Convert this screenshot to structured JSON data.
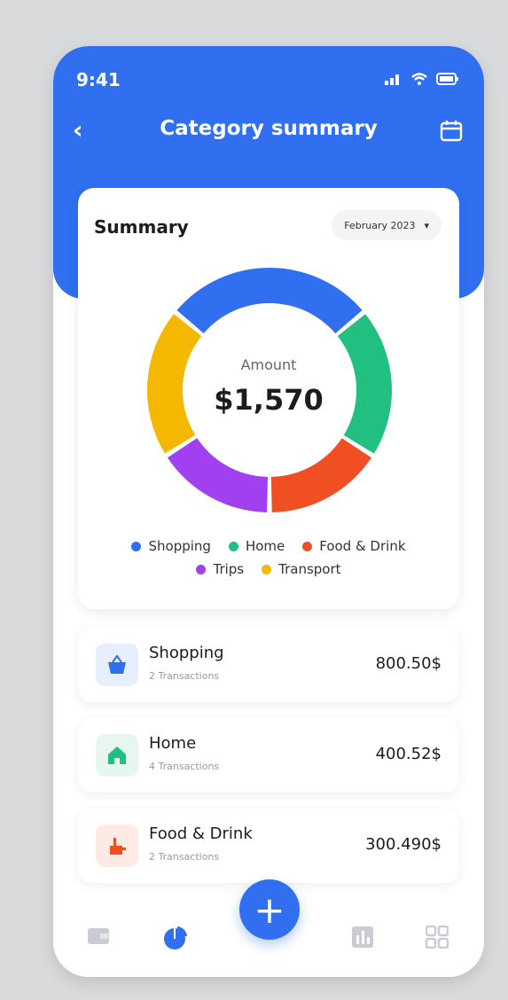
{
  "status_bar": {
    "time": "9:41"
  },
  "header": {
    "title": "Category summary"
  },
  "summary": {
    "title": "Summary",
    "month": "February 2023",
    "amount_label": "Amount",
    "amount_value": "$1,570"
  },
  "chart_data": {
    "type": "pie",
    "categories": [
      "Shopping",
      "Home",
      "Food & Drink",
      "Trips",
      "Transport"
    ],
    "values": [
      28,
      20,
      16,
      16,
      20
    ],
    "colors": [
      "#2f6ff0",
      "#22c080",
      "#f04f23",
      "#a040f0",
      "#f5b800"
    ]
  },
  "legend": [
    {
      "label": "Shopping",
      "color": "#2f6ff0"
    },
    {
      "label": "Home",
      "color": "#22c080"
    },
    {
      "label": "Food & Drink",
      "color": "#f04f23"
    },
    {
      "label": "Trips",
      "color": "#a040f0"
    },
    {
      "label": "Transport",
      "color": "#f5b800"
    }
  ],
  "categories": [
    {
      "name": "Shopping",
      "transactions": "2 Transactions",
      "amount": "800.50$",
      "icon": "basket-icon",
      "color": "#2f6ff0"
    },
    {
      "name": "Home",
      "transactions": "4 Transactions",
      "amount": "400.52$",
      "icon": "home-icon",
      "color": "#22c080"
    },
    {
      "name": "Food & Drink",
      "transactions": "2 Transactions",
      "amount": "300.490$",
      "icon": "food-icon",
      "color": "#f04f23"
    }
  ],
  "fab": {
    "label": "+"
  },
  "nav": [
    "wallet-icon",
    "pie-chart-icon",
    "bar-chart-icon",
    "grid-icon"
  ]
}
